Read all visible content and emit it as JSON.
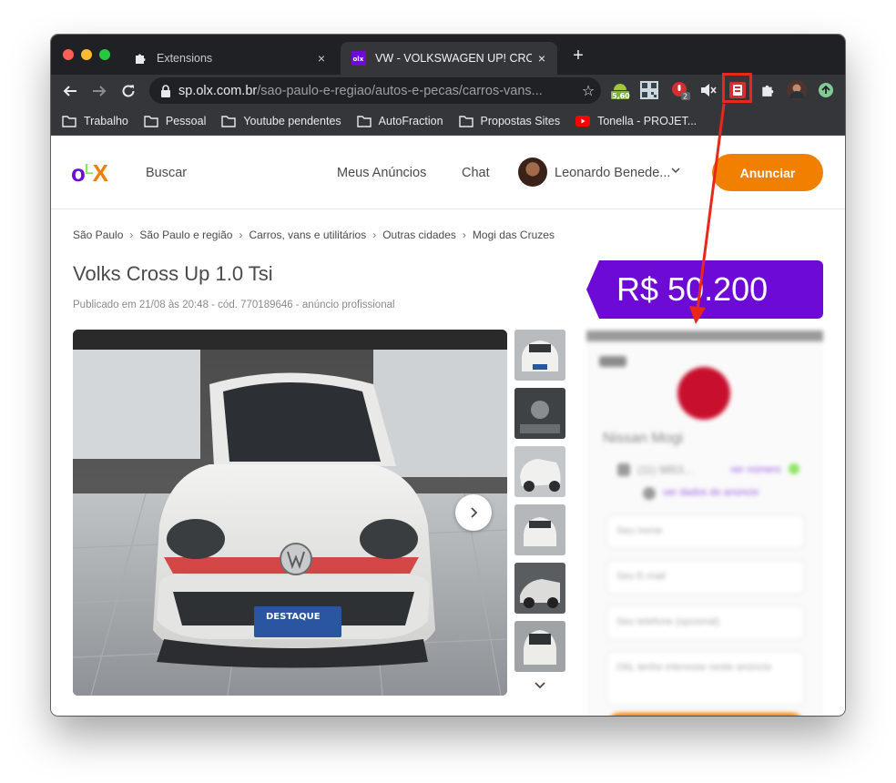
{
  "browser": {
    "tabs": [
      {
        "title": "Extensions",
        "active": false,
        "icon": "puzzle-icon"
      },
      {
        "title": "VW - VOLKSWAGEN UP! CROS",
        "active": true,
        "icon": "olx-favicon"
      }
    ],
    "tab_close_symbol": "×",
    "new_tab_symbol": "+",
    "url_host": "sp.olx.com.br",
    "url_path": "/sao-paulo-e-regiao/autos-e-pecas/carros-vans...",
    "extensions": [
      {
        "name": "android-badge-icon",
        "badge": "5,60"
      },
      {
        "name": "qr-extension-icon"
      },
      {
        "name": "record-extension-icon",
        "badge": "2"
      },
      {
        "name": "mute-tab-icon"
      },
      {
        "name": "highlighted-extension-icon"
      },
      {
        "name": "extensions-puzzle-icon"
      },
      {
        "name": "profile-avatar-icon"
      },
      {
        "name": "update-arrow-icon"
      }
    ],
    "bookmarks": [
      {
        "label": "Trabalho",
        "icon": "folder-icon"
      },
      {
        "label": "Pessoal",
        "icon": "folder-icon"
      },
      {
        "label": "Youtube pendentes",
        "icon": "folder-icon"
      },
      {
        "label": "AutoFraction",
        "icon": "folder-icon"
      },
      {
        "label": "Propostas Sites",
        "icon": "folder-icon"
      },
      {
        "label": "Tonella - PROJET...",
        "icon": "youtube-icon"
      }
    ]
  },
  "site": {
    "logo": {
      "o": "o",
      "l": "L",
      "x": "X"
    },
    "nav": {
      "search": "Buscar",
      "my_ads": "Meus Anúncios",
      "chat": "Chat"
    },
    "user_name": "Leonardo Benede...",
    "cta": "Anunciar",
    "breadcrumb": [
      "São Paulo",
      "São Paulo e região",
      "Carros, vans e utilitários",
      "Outras cidades",
      "Mogi das Cruzes"
    ],
    "ad": {
      "title": "Volks Cross Up 1.0 Tsi",
      "meta": "Publicado em 21/08 às 20:48 - cód. 770189646 - anúncio profissional",
      "price": "R$ 50.200",
      "plate_text": "DESTAQUE"
    },
    "seller": {
      "name": "Nissan Mogi",
      "phone": "(11) 9853...",
      "phone_action": "ver número",
      "email_action": "ver dados do anúncio",
      "fields": [
        "Seu nome",
        "Seu E-mail",
        "Seu telefone (opcional)",
        "Olá, tenho interesse neste anúncio"
      ]
    }
  },
  "colors": {
    "olx_purple": "#6e0ad6",
    "olx_orange": "#f28000",
    "olx_green": "#8ce563",
    "annotation_red": "#e8281a"
  }
}
